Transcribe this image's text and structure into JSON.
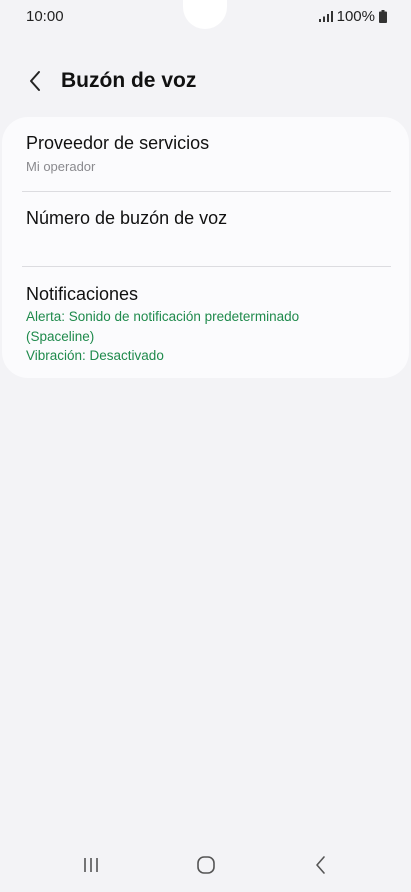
{
  "status_bar": {
    "time": "10:00",
    "battery": "100%",
    "icons": [
      "signal-icon",
      "battery-icon"
    ]
  },
  "header": {
    "back_icon": "chevron-left-icon",
    "title": "Buzón de voz"
  },
  "settings": {
    "service_provider": {
      "title": "Proveedor de servicios",
      "value": "Mi operador"
    },
    "voicemail_number": {
      "title": "Número de buzón de voz"
    },
    "notifications": {
      "title": "Notificaciones",
      "alert": "Alerta: Sonido de notificación predeterminado (Spaceline)",
      "vibration": "Vibración: Desactivado"
    }
  },
  "nav_bar": {
    "icons": [
      "recent-apps-icon",
      "home-icon",
      "back-icon"
    ]
  },
  "colors": {
    "background": "#f3f3f6",
    "card": "#fbfbfd",
    "accent_green": "#1f8a4c",
    "secondary_text": "#8a8a8e"
  }
}
